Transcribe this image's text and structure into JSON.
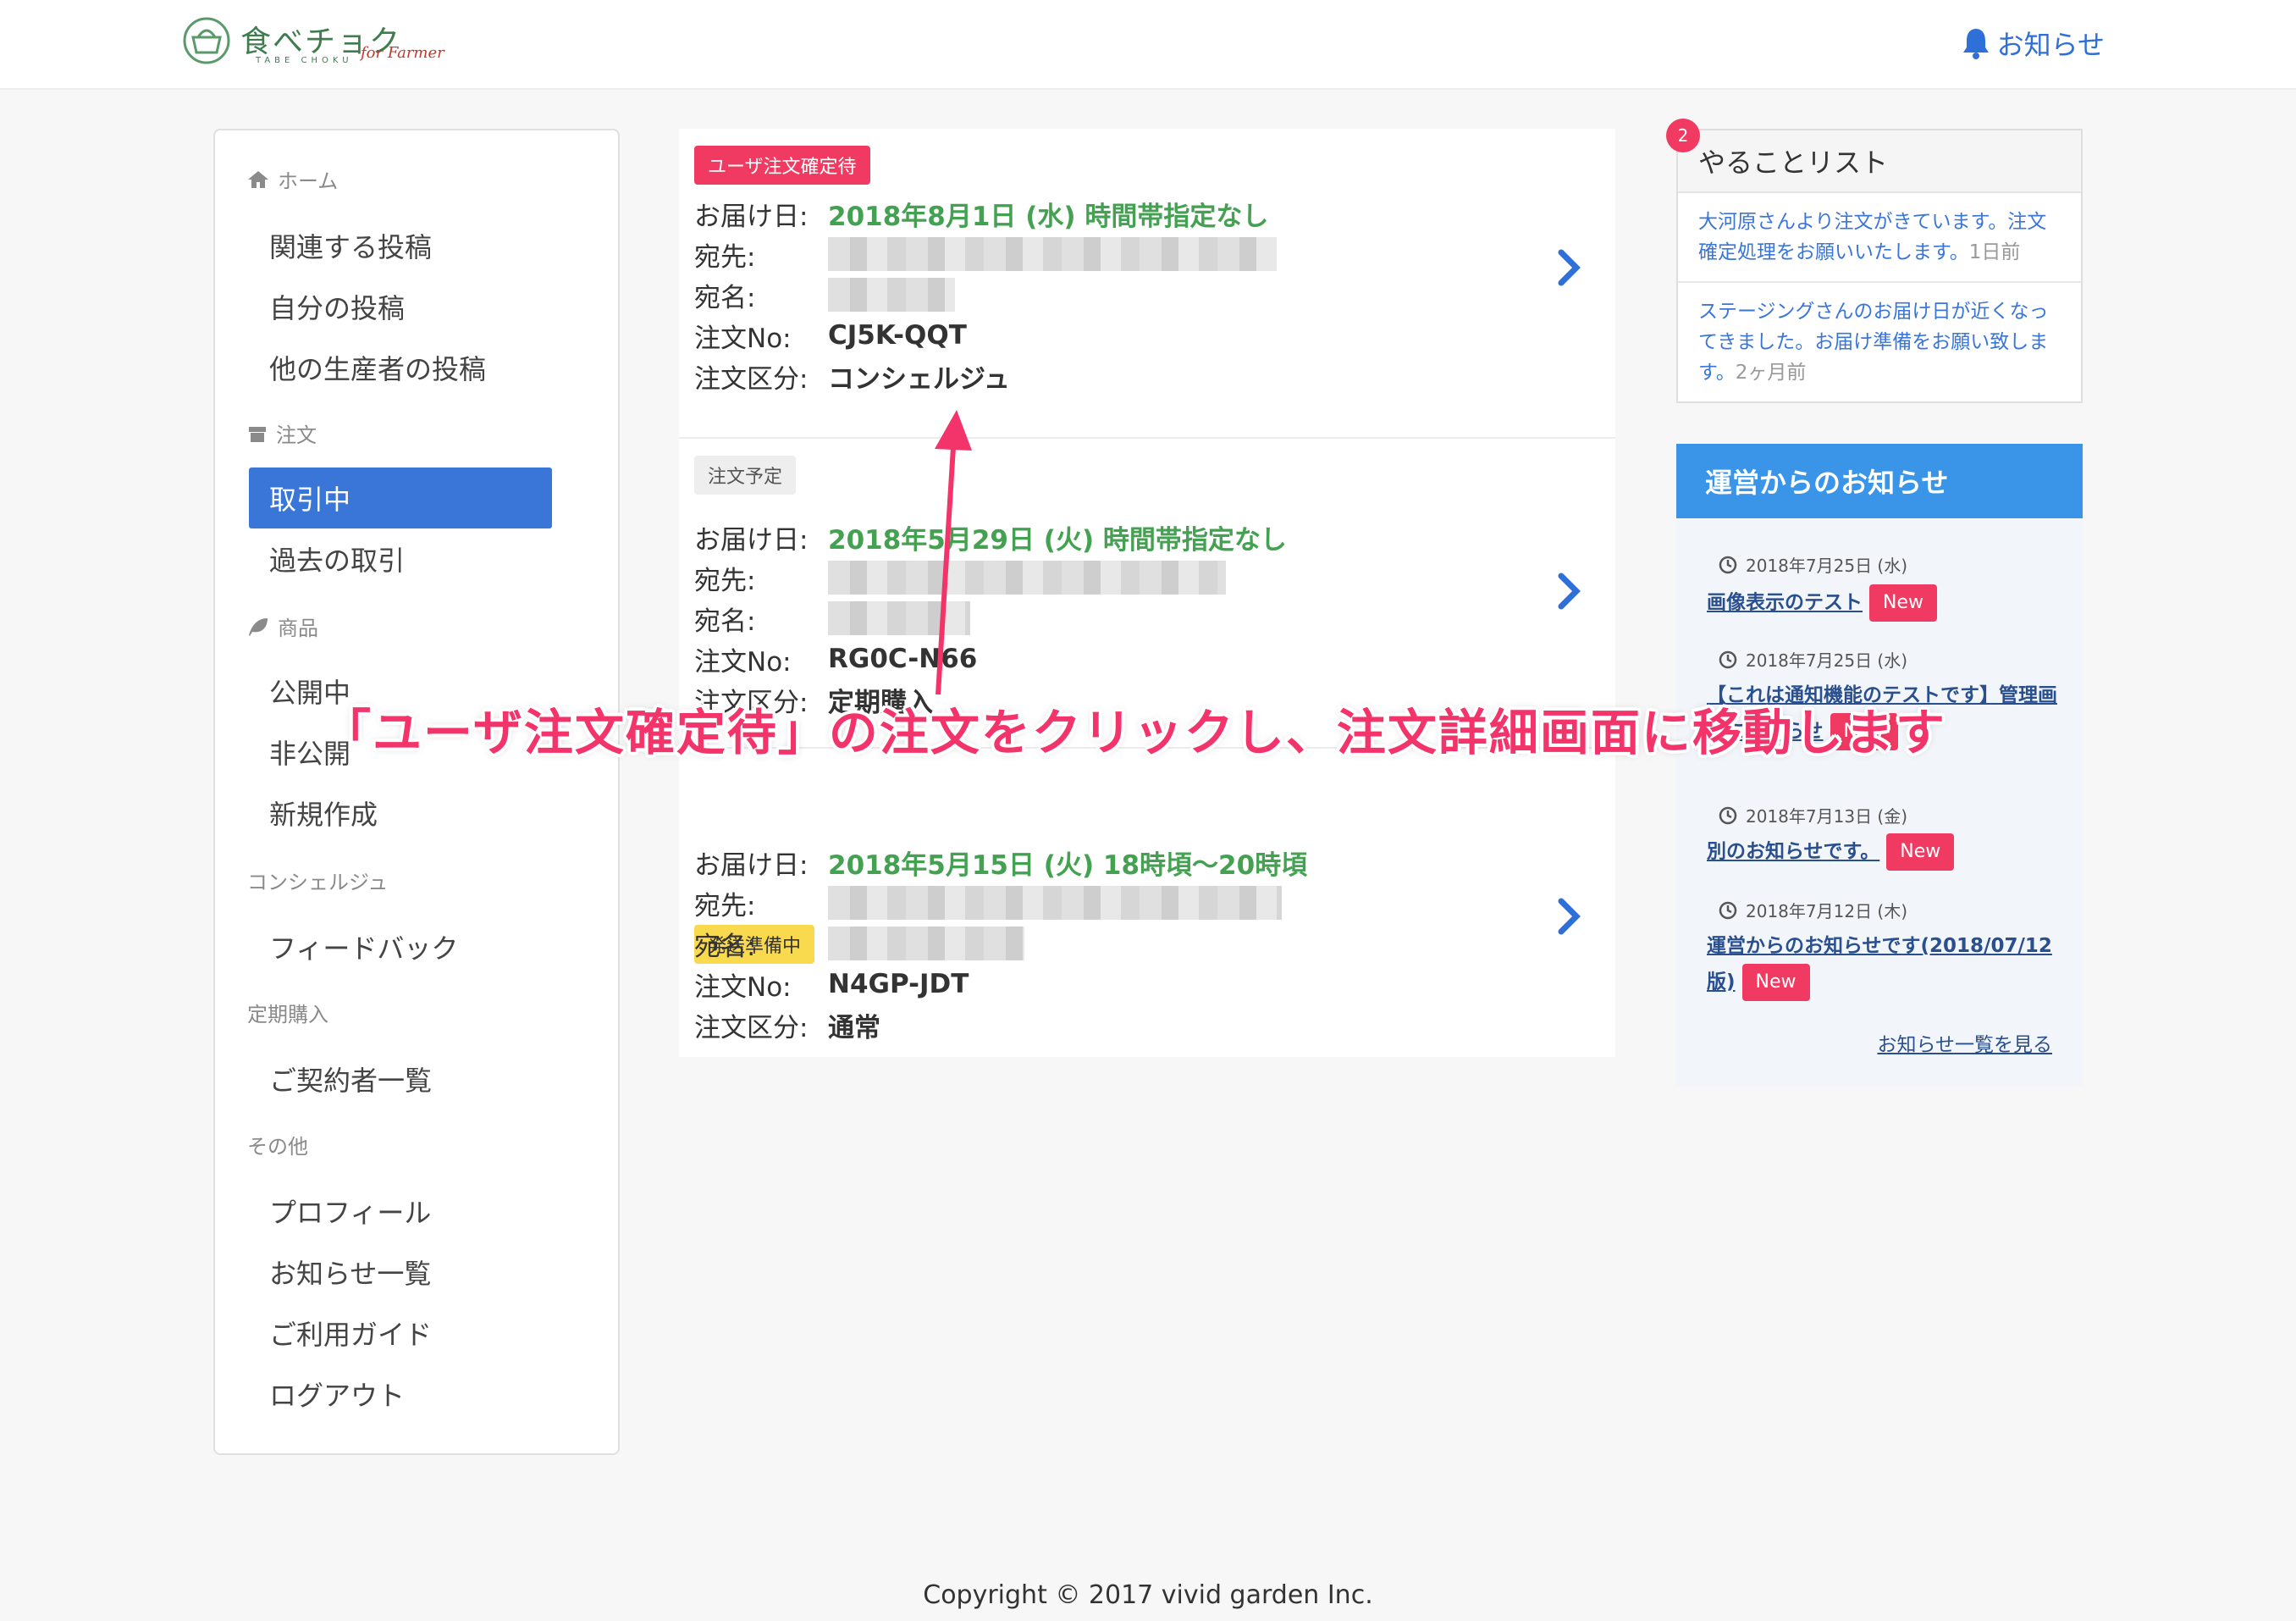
{
  "header": {
    "logo_main": "食べチョク",
    "logo_sub": "TABE CHOKU",
    "logo_farmer": "for Farmer",
    "notice_label": "お知らせ"
  },
  "sidebar": {
    "home_label": "ホーム",
    "home_items": [
      "関連する投稿",
      "自分の投稿",
      "他の生産者の投稿"
    ],
    "order_label": "注文",
    "order_items": [
      "取引中",
      "過去の取引"
    ],
    "product_label": "商品",
    "product_items": [
      "公開中",
      "非公開",
      "新規作成"
    ],
    "concierge_label": "コンシェルジュ",
    "concierge_items": [
      "フィードバック"
    ],
    "subscription_label": "定期購入",
    "subscription_items": [
      "ご契約者一覧"
    ],
    "other_label": "その他",
    "other_items": [
      "プロフィール",
      "お知らせ一覧",
      "ご利用ガイド",
      "ログアウト"
    ]
  },
  "field_labels": {
    "delivery": "お届け日:",
    "address": "宛先:",
    "name": "宛名:",
    "order_no": "注文No:",
    "type": "注文区分:"
  },
  "orders": [
    {
      "status": "ユーザ注文確定待",
      "status_color": "#f03a62",
      "delivery": "2018年8月1日 (水) 時間帯指定なし",
      "order_no": "CJ5K-QQT",
      "type": "コンシェルジュ"
    },
    {
      "status": "注文予定",
      "status_color": "#eeeeee",
      "delivery": "2018年5月29日 (火) 時間帯指定なし",
      "order_no": "RG0C-N66",
      "type": "定期購入"
    },
    {
      "status": "発送準備中",
      "status_color": "#f9d94e",
      "delivery": "2018年5月15日 (火) 18時頃〜20時頃",
      "order_no": "N4GP-JDT",
      "type": "通常"
    }
  ],
  "todo": {
    "title": "やることリスト",
    "count": "2",
    "items": [
      {
        "text": "大河原さんより注文がきています。注文確定処理をお願いいたします。",
        "ago": "1日前"
      },
      {
        "text": "ステージングさんのお届け日が近くなってきました。お届け準備をお願い致します。",
        "ago": "2ヶ月前"
      }
    ]
  },
  "news": {
    "title": "運営からのお知らせ",
    "new_label": "New",
    "items": [
      {
        "date": "2018年7月25日 (水)",
        "title": "画像表示のテスト"
      },
      {
        "date": "2018年7月25日 (水)",
        "title": "【これは通知機能のテストです】管理画面にお知らせ"
      },
      {
        "date": "2018年7月13日 (金)",
        "title": "別のお知らせです。"
      },
      {
        "date": "2018年7月12日 (木)",
        "title": "運営からのお知らせです(2018/07/12版)"
      }
    ],
    "more": "お知らせ一覧を見る"
  },
  "footer": "Copyright © 2017 vivid garden Inc.",
  "annotation": "「ユーザ注文確定待」の注文をクリックし、注文詳細画面に移動します",
  "colors": {
    "accent": "#3a75d8",
    "green": "#45a152",
    "pink": "#f03a62",
    "news_header": "#3a95e8"
  }
}
